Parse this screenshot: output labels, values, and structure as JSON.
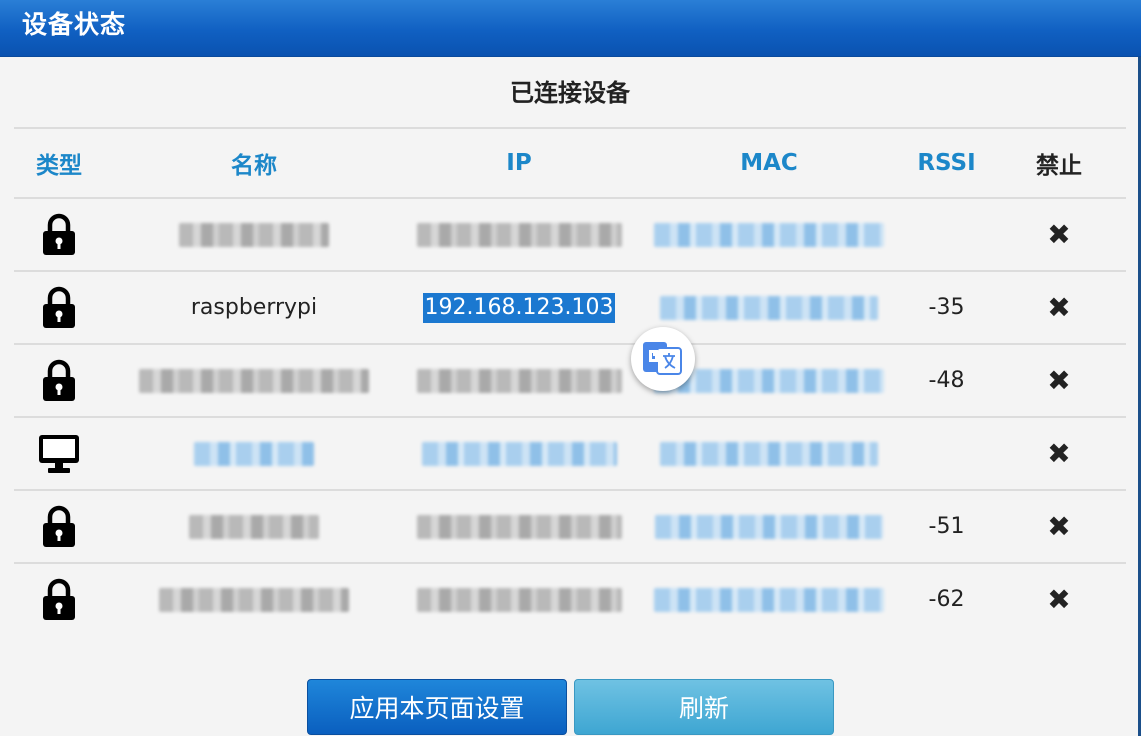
{
  "window": {
    "title": "设备状态"
  },
  "panel": {
    "heading": "已连接设备"
  },
  "table": {
    "columns": {
      "type": "类型",
      "name": "名称",
      "ip": "IP",
      "mac": "MAC",
      "rssi": "RSSI",
      "ban": "禁止"
    },
    "rows": [
      {
        "type_icon": "lock-icon",
        "name": "",
        "ip": "",
        "mac": "",
        "rssi": "",
        "ban": "✖"
      },
      {
        "type_icon": "lock-icon",
        "name": "raspberrypi",
        "ip": "192.168.123.103",
        "mac": "",
        "rssi": "-35",
        "ban": "✖"
      },
      {
        "type_icon": "lock-icon",
        "name": "",
        "ip": "",
        "mac": "",
        "rssi": "-48",
        "ban": "✖"
      },
      {
        "type_icon": "monitor-icon",
        "name": "",
        "ip": "",
        "mac": "",
        "rssi": "",
        "ban": "✖"
      },
      {
        "type_icon": "lock-icon",
        "name": "",
        "ip": "",
        "mac": "",
        "rssi": "-51",
        "ban": "✖"
      },
      {
        "type_icon": "lock-icon",
        "name": "",
        "ip": "",
        "mac": "",
        "rssi": "-62",
        "ban": "✖"
      }
    ]
  },
  "buttons": {
    "apply": "应用本页面设置",
    "refresh": "刷新"
  },
  "colors": {
    "titlebar": "#1060c2",
    "header_text": "#1c87c9",
    "apply_button": "#0a5fbf",
    "refresh_button": "#3ea6d2",
    "selection": "#1b78d0"
  }
}
